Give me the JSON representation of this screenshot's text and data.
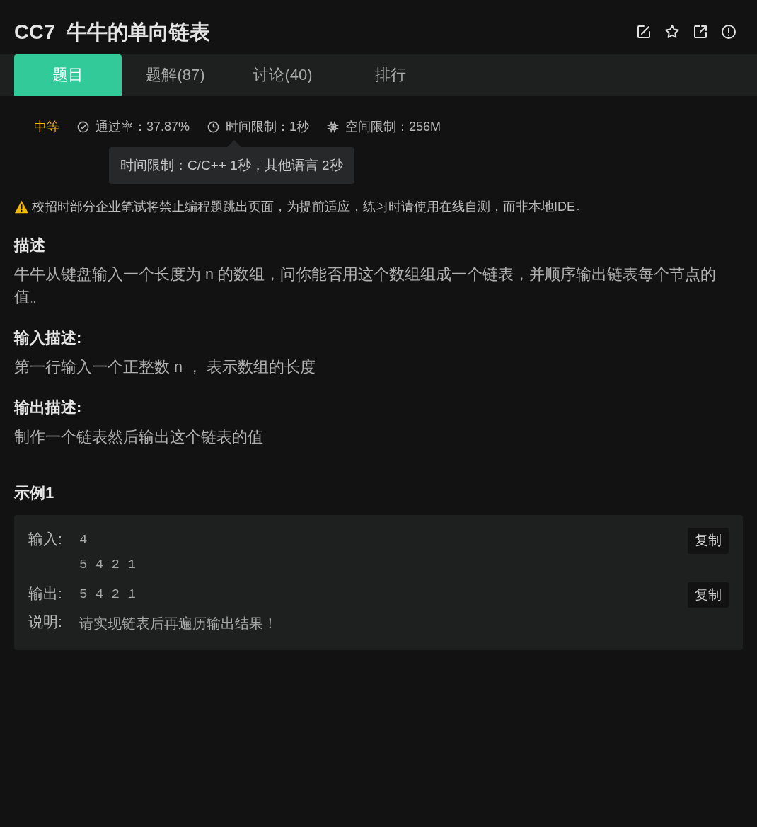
{
  "problem": {
    "code": "CC7",
    "title": "牛牛的单向链表"
  },
  "tabs": [
    {
      "label": "题目",
      "selected": true
    },
    {
      "label": "题解(87)",
      "selected": false
    },
    {
      "label": "讨论(40)",
      "selected": false
    },
    {
      "label": "排行",
      "selected": false
    }
  ],
  "meta": {
    "difficulty": "中等",
    "pass_rate": "通过率：37.87%",
    "time_limit": "时间限制：1秒",
    "space_limit": "空间限制：256M"
  },
  "tooltip": "时间限制：C/C++ 1秒，其他语言 2秒",
  "warning": "校招时部分企业笔试将禁止编程题跳出页面，为提前适应，练习时请使用在线自测，而非本地IDE。",
  "sections": [
    {
      "heading": "描述",
      "text": "牛牛从键盘输入一个长度为 n 的数组，问你能否用这个数组组成一个链表，并顺序输出链表每个节点的值。"
    },
    {
      "heading": "输入描述:",
      "text": "第一行输入一个正整数 n ， 表示数组的长度"
    },
    {
      "heading": "输出描述:",
      "text": "制作一个链表然后输出这个链表的值"
    }
  ],
  "example": {
    "title": "示例1",
    "rows": [
      {
        "kind": "io",
        "label": "输入:",
        "lines": [
          "4",
          "5 4 2 1"
        ],
        "copy": "复制"
      },
      {
        "kind": "io",
        "label": "输出:",
        "lines": [
          "5 4 2 1"
        ],
        "copy": "复制"
      },
      {
        "kind": "note",
        "label": "说明:",
        "lines": [
          "请实现链表后再遍历输出结果！"
        ]
      }
    ]
  }
}
